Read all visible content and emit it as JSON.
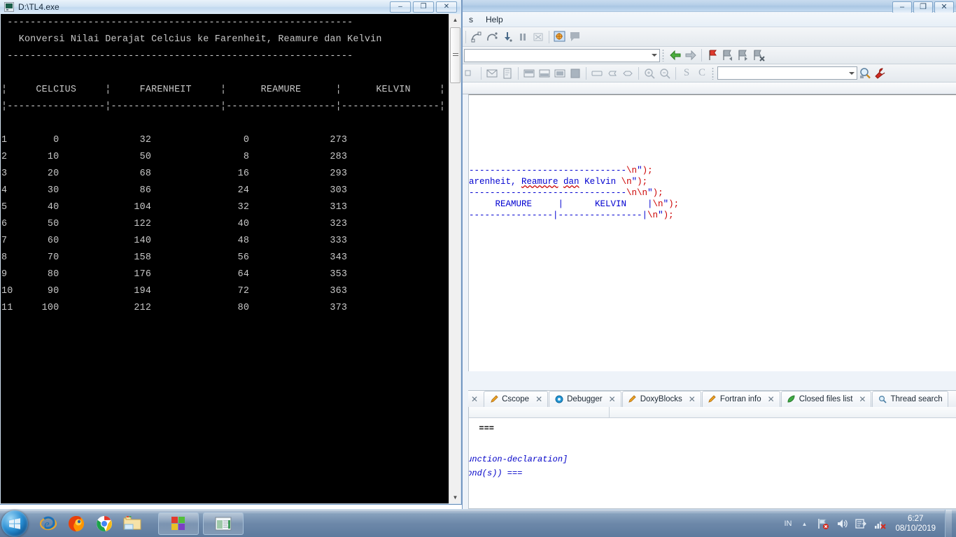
{
  "console_window": {
    "title": "D:\\TL4.exe",
    "icon": "console-icon",
    "buttons": {
      "minimize": "–",
      "maximize": "❐",
      "close": "✕"
    },
    "output": {
      "rule_top": "------------------------------------------------------------",
      "heading": "   Konversi Nilai Derajat Celcius ke Farenheit, Reamure dan Kelvin",
      "rule_under_heading": "------------------------------------------------------------",
      "blank": "",
      "header_row": "¦     CELCIUS     ¦     FARENHEIT     ¦      REAMURE      ¦      KELVIN     ¦",
      "header_rule": "¦-----------------¦-------------------¦-------------------¦-----------------¦",
      "columns": [
        "CELCIUS",
        "FARENHEIT",
        "REAMURE",
        "KELVIN"
      ],
      "rows": [
        {
          "no": "1",
          "celcius": "0",
          "farenheit": "32",
          "reamure": "0",
          "kelvin": "273"
        },
        {
          "no": "2",
          "celcius": "10",
          "farenheit": "50",
          "reamure": "8",
          "kelvin": "283"
        },
        {
          "no": "3",
          "celcius": "20",
          "farenheit": "68",
          "reamure": "16",
          "kelvin": "293"
        },
        {
          "no": "4",
          "celcius": "30",
          "farenheit": "86",
          "reamure": "24",
          "kelvin": "303"
        },
        {
          "no": "5",
          "celcius": "40",
          "farenheit": "104",
          "reamure": "32",
          "kelvin": "313"
        },
        {
          "no": "6",
          "celcius": "50",
          "farenheit": "122",
          "reamure": "40",
          "kelvin": "323"
        },
        {
          "no": "7",
          "celcius": "60",
          "farenheit": "140",
          "reamure": "48",
          "kelvin": "333"
        },
        {
          "no": "8",
          "celcius": "70",
          "farenheit": "158",
          "reamure": "56",
          "kelvin": "343"
        },
        {
          "no": "9",
          "celcius": "80",
          "farenheit": "176",
          "reamure": "64",
          "kelvin": "353"
        },
        {
          "no": "10",
          "celcius": "90",
          "farenheit": "194",
          "reamure": "72",
          "kelvin": "363"
        },
        {
          "no": "11",
          "celcius": "100",
          "farenheit": "212",
          "reamure": "80",
          "kelvin": "373"
        }
      ],
      "text_color": "#c8c8c8",
      "background_color": "#000000"
    }
  },
  "ide_window": {
    "buttons": {
      "minimize": "–",
      "maximize": "❐",
      "close": "✕"
    },
    "menu": [
      {
        "label": "s"
      },
      {
        "label": "Help"
      }
    ],
    "toolbar2_combo_value": "",
    "toolbar3_combo_value": "",
    "editor_code_lines": [
      {
        "segments": [
          {
            "t": "------------------------------",
            "c": "str"
          },
          {
            "t": "\\n",
            "c": "esc"
          },
          {
            "t": "\"",
            "c": "str"
          },
          {
            "t": ");",
            "c": "pun"
          }
        ]
      },
      {
        "segments": [
          {
            "t": "arenheit, ",
            "c": "str"
          },
          {
            "t": "Reamure",
            "c": "spell"
          },
          {
            "t": " ",
            "c": "str"
          },
          {
            "t": "dan",
            "c": "spell"
          },
          {
            "t": " Kelvin ",
            "c": "str"
          },
          {
            "t": "\\n",
            "c": "esc"
          },
          {
            "t": "\"",
            "c": "str"
          },
          {
            "t": ");",
            "c": "pun"
          }
        ]
      },
      {
        "segments": [
          {
            "t": "------------------------------",
            "c": "str"
          },
          {
            "t": "\\n\\n",
            "c": "esc"
          },
          {
            "t": "\"",
            "c": "str"
          },
          {
            "t": ");",
            "c": "pun"
          }
        ]
      },
      {
        "segments": [
          {
            "t": "     REAMURE     |      KELVIN    |",
            "c": "str"
          },
          {
            "t": "\\n",
            "c": "esc"
          },
          {
            "t": "\"",
            "c": "str"
          },
          {
            "t": ");",
            "c": "pun"
          }
        ]
      },
      {
        "segments": [
          {
            "t": "----------------|----------------|",
            "c": "str"
          },
          {
            "t": "\\n",
            "c": "esc"
          },
          {
            "t": "\"",
            "c": "str"
          },
          {
            "t": ");",
            "c": "pun"
          }
        ]
      }
    ],
    "bottom_tabs": [
      {
        "label": "Cscope",
        "icon": "pencil-icon",
        "close": "✕"
      },
      {
        "label": "Debugger",
        "icon": "gear-blue-icon",
        "close": "✕"
      },
      {
        "label": "DoxyBlocks",
        "icon": "pencil-icon",
        "close": "✕"
      },
      {
        "label": "Fortran info",
        "icon": "pencil-icon",
        "close": "✕"
      },
      {
        "label": "Closed files list",
        "icon": "leaf-icon",
        "close": "✕"
      },
      {
        "label": "Thread search",
        "icon": "magnifier-icon",
        "close": ""
      }
    ],
    "bottom_log_lines": [
      {
        "text": "  ===",
        "style": "plain"
      },
      {
        "text": "",
        "style": "plain"
      },
      {
        "text": "function-declaration]",
        "style": "italic"
      },
      {
        "text": "cond(s)) ===",
        "style": "italic"
      }
    ]
  },
  "taskbar": {
    "start_label": "Start",
    "quick_launch": [
      {
        "name": "internet-explorer-icon"
      },
      {
        "name": "firefox-icon"
      },
      {
        "name": "chrome-icon"
      },
      {
        "name": "file-explorer-icon"
      }
    ],
    "task_buttons": [
      {
        "name": "codeblocks-window-button"
      },
      {
        "name": "console-window-button"
      }
    ],
    "tray": {
      "language": "IN",
      "show_hidden": "▲",
      "icons": [
        "network-error-icon",
        "volume-icon",
        "action-center-icon",
        "signal-error-icon"
      ],
      "time": "6:27",
      "date": "08/10/2019"
    }
  }
}
